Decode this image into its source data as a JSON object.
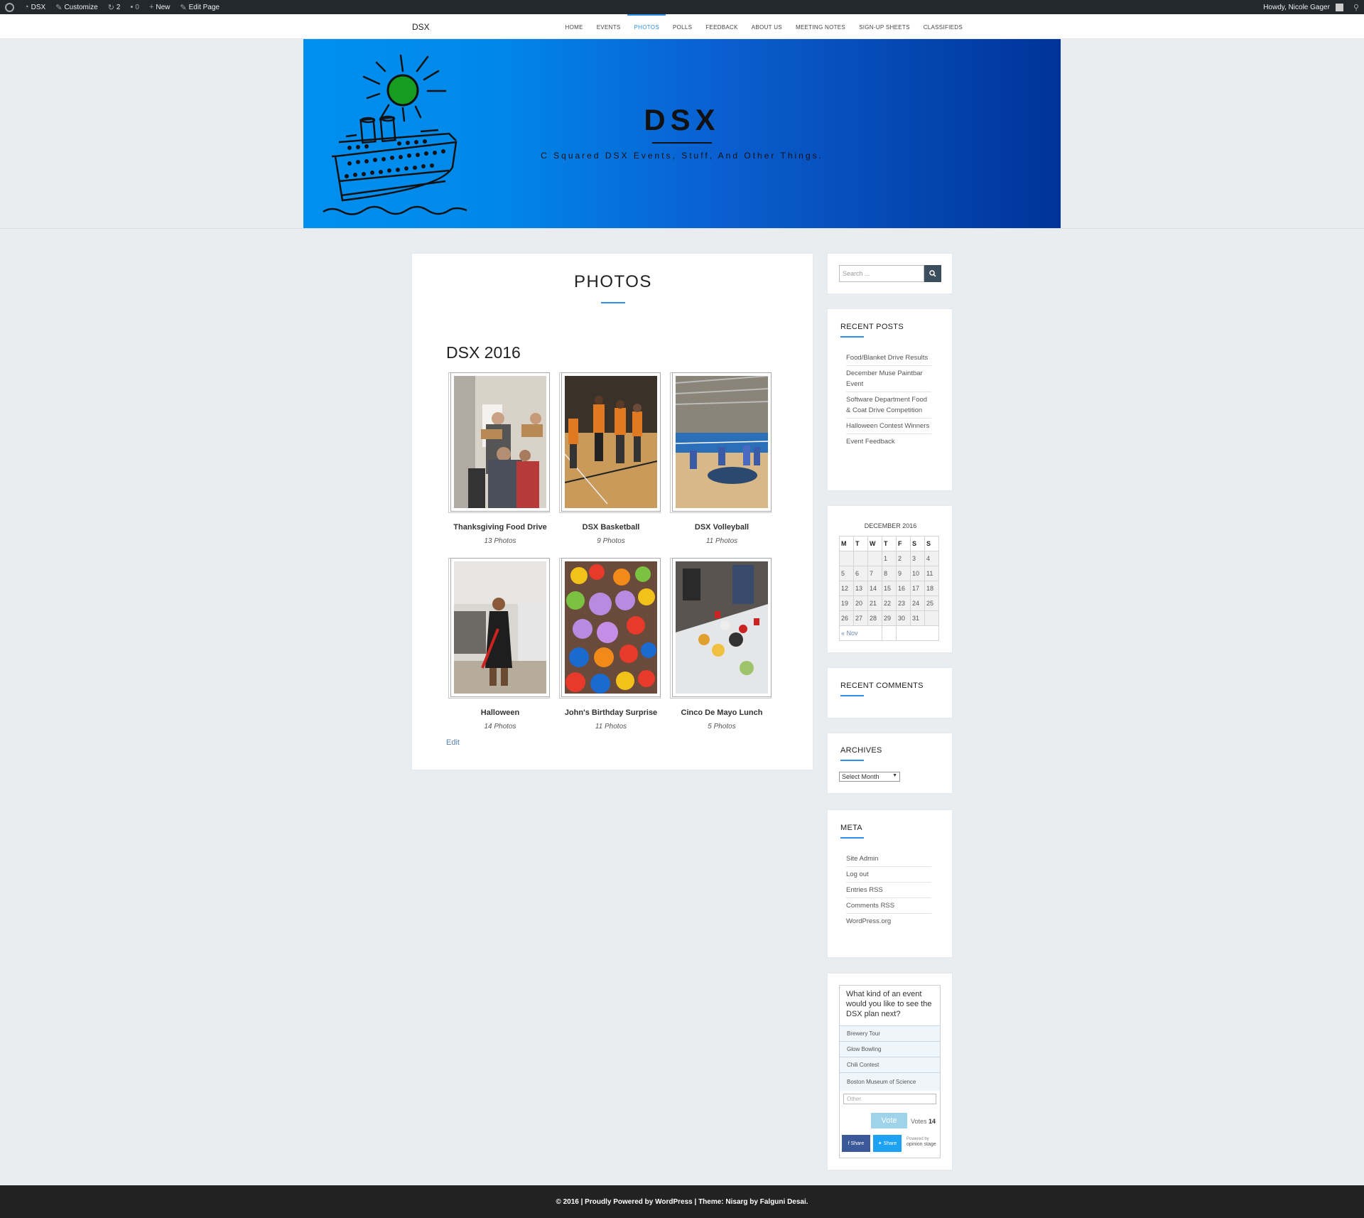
{
  "admin_bar": {
    "site_name": "DSX",
    "customize": "Customize",
    "updates_count": "2",
    "comments_count": "0",
    "new_label": "New",
    "edit_page": "Edit Page",
    "greeting": "Howdy, Nicole Gager"
  },
  "nav": {
    "brand": "DSX",
    "items": [
      "HOME",
      "EVENTS",
      "PHOTOS",
      "POLLS",
      "FEEDBACK",
      "ABOUT US",
      "MEETING NOTES",
      "SIGN-UP SHEETS",
      "CLASSIFIEDS"
    ],
    "active": "PHOTOS"
  },
  "hero": {
    "title": "DSX",
    "subtitle": "C Squared DSX Events, Stuff, And Other Things."
  },
  "page": {
    "title": "PHOTOS",
    "gallery_title": "DSX 2016",
    "albums": [
      {
        "name": "Thanksgiving Food Drive",
        "count": "13 Photos"
      },
      {
        "name": "DSX Basketball",
        "count": "9 Photos"
      },
      {
        "name": "DSX Volleyball",
        "count": "11 Photos"
      },
      {
        "name": "Halloween",
        "count": "14 Photos"
      },
      {
        "name": "John's Birthday Surprise",
        "count": "11 Photos"
      },
      {
        "name": "Cinco De Mayo Lunch",
        "count": "5 Photos"
      }
    ],
    "edit_label": "Edit"
  },
  "sidebar": {
    "search_placeholder": "Search ...",
    "recent_posts": {
      "title": "RECENT POSTS",
      "items": [
        "Food/Blanket Drive Results",
        "December Muse Paintbar Event",
        "Software Department Food & Coat Drive Competition",
        "Halloween Contest Winners",
        "Event Feedback"
      ]
    },
    "calendar": {
      "caption": "DECEMBER 2016",
      "days": [
        "M",
        "T",
        "W",
        "T",
        "F",
        "S",
        "S"
      ],
      "weeks": [
        [
          "",
          "",
          "",
          "1",
          "2",
          "3",
          "4"
        ],
        [
          "5",
          "6",
          "7",
          "8",
          "9",
          "10",
          "11"
        ],
        [
          "12",
          "13",
          "14",
          "15",
          "16",
          "17",
          "18"
        ],
        [
          "19",
          "20",
          "21",
          "22",
          "23",
          "24",
          "25"
        ],
        [
          "26",
          "27",
          "28",
          "29",
          "30",
          "31",
          ""
        ]
      ],
      "prev": "« Nov"
    },
    "recent_comments": {
      "title": "RECENT COMMENTS"
    },
    "archives": {
      "title": "ARCHIVES",
      "select": "Select Month"
    },
    "meta": {
      "title": "META",
      "items": [
        "Site Admin",
        "Log out",
        "Entries RSS",
        "Comments RSS",
        "WordPress.org"
      ]
    },
    "poll": {
      "question": "What kind of an event would you like to see the DSX plan next?",
      "options": [
        "Brewery Tour",
        "Glow Bowling",
        "Chili Contest",
        "Boston Museum of Science"
      ],
      "other_placeholder": "Other",
      "vote_label": "Vote",
      "votes_label": "Votes",
      "votes_count": "14",
      "share_facebook": "f Share",
      "share_twitter": "Share",
      "powered_by": "Powered by",
      "powered_brand": "opinion stage"
    }
  },
  "footer": {
    "text": "© 2016 | Proudly Powered by WordPress | Theme: Nisarg by Falguni Desai."
  },
  "colors": {
    "accent": "#2f8fea",
    "admin_bar": "#23282d",
    "hero_left": "#0090f0",
    "hero_right": "#003399",
    "footer": "#222222"
  }
}
